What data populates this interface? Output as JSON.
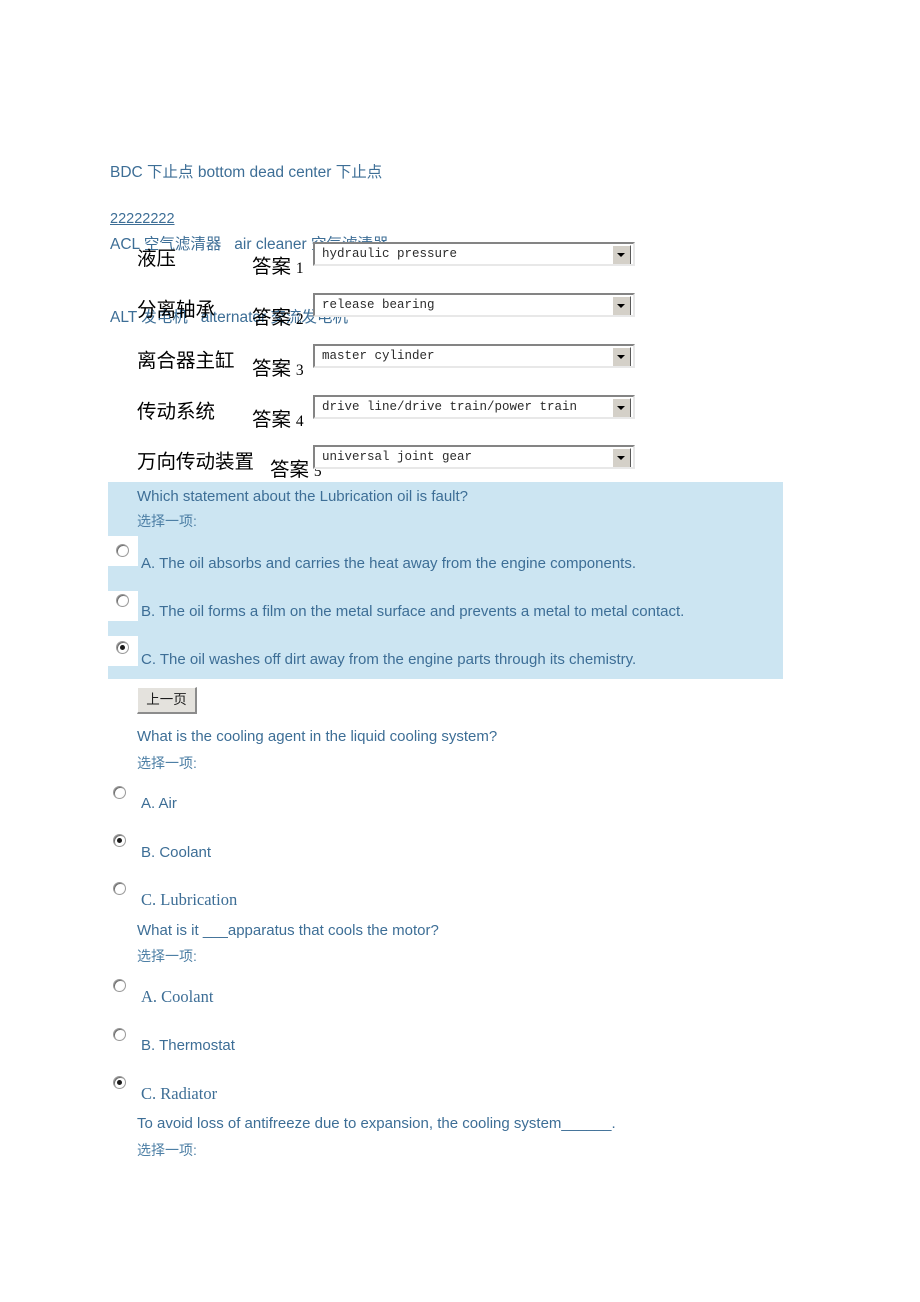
{
  "glossary": {
    "lines": [
      "BDC 下止点 bottom dead center 下止点",
      "ACL 空气滤清器   air cleaner 空气滤清器",
      "ALT 发电机   alternator 交流发电机"
    ]
  },
  "num_link": {
    "label": "22222222"
  },
  "answer_label": "答案",
  "terms": [
    {
      "cn": "液压",
      "index": "1",
      "value": "hydraulic pressure"
    },
    {
      "cn": "分离轴承",
      "index": "2",
      "value": "release bearing"
    },
    {
      "cn": "离合器主缸",
      "index": "3",
      "value": "master cylinder"
    },
    {
      "cn": "传动系统",
      "index": "4",
      "value": "drive line/drive train/power train"
    },
    {
      "cn": "万向传动装置",
      "index": "5",
      "value": "universal joint gear"
    }
  ],
  "choose_one": "选择一项:",
  "questions": [
    {
      "prompt": "Which statement about the Lubrication oil is fault?",
      "sub": "选择一项:",
      "options": [
        {
          "label": "A. The oil absorbs and carries the heat away from the engine components.",
          "selected": false
        },
        {
          "label": "B. The oil forms a film on the metal surface and prevents a metal to metal contact.",
          "selected": false
        },
        {
          "label": "C. The oil washes off dirt away from the engine parts through its chemistry.",
          "selected": true
        }
      ]
    },
    {
      "prompt": "What is the cooling agent in the liquid cooling system?",
      "sub": "选择一项:",
      "options": [
        {
          "label": "A. Air",
          "selected": false
        },
        {
          "label": "B. Coolant",
          "selected": true
        },
        {
          "label": "C. Lubrication",
          "selected": false
        }
      ]
    },
    {
      "prompt": "What is it ___apparatus that cools the motor?",
      "sub": "选择一项:",
      "options": [
        {
          "label": "A. Coolant",
          "selected": false
        },
        {
          "label": "B. Thermostat",
          "selected": false
        },
        {
          "label": "C. Radiator",
          "selected": true
        }
      ]
    },
    {
      "prompt": "To avoid loss of antifreeze due to expansion, the cooling system______.",
      "sub": "选择一项:",
      "options": []
    }
  ],
  "prev_button": {
    "label": "上一页"
  },
  "colors": {
    "text_blue": "#3d6e96",
    "highlight_bg": "#cce5f2",
    "button_face": "#e4e2dd"
  }
}
